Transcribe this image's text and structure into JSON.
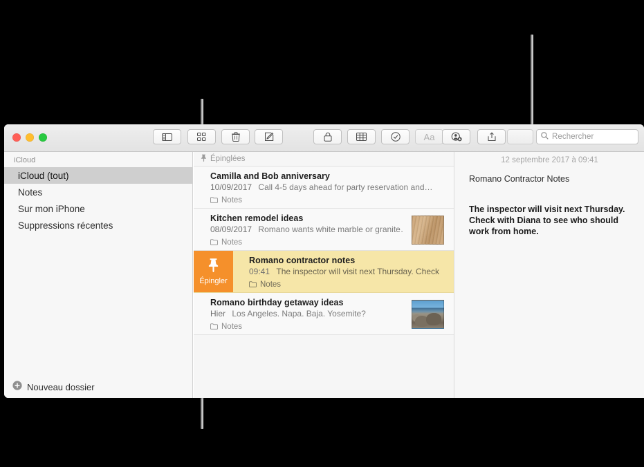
{
  "window": {
    "traffic_lights": [
      "close",
      "minimize",
      "zoom"
    ]
  },
  "toolbar": {
    "buttons": [
      {
        "name": "sidebar-toggle-button",
        "icon": "sidebar-icon"
      },
      {
        "name": "gallery-view-button",
        "icon": "grid-icon"
      },
      {
        "name": "delete-note-button",
        "icon": "trash-icon"
      },
      {
        "name": "new-note-button",
        "icon": "compose-icon"
      },
      {
        "name": "lock-note-button",
        "icon": "lock-icon"
      },
      {
        "name": "add-table-button",
        "icon": "table-icon"
      },
      {
        "name": "checklist-button",
        "icon": "checkmark-circle-icon"
      },
      {
        "name": "format-button",
        "icon": "aa-icon",
        "label": "Aa"
      },
      {
        "name": "add-people-button",
        "icon": "add-person-icon"
      },
      {
        "name": "share-button",
        "icon": "share-icon"
      }
    ],
    "format_label": "Aa"
  },
  "search": {
    "placeholder": "Rechercher",
    "icon": "search-icon",
    "value": ""
  },
  "sidebar": {
    "header": "iCloud",
    "items": [
      {
        "label": "iCloud (tout)",
        "selected": true
      },
      {
        "label": "Notes",
        "selected": false
      },
      {
        "label": "Sur mon iPhone",
        "selected": false
      },
      {
        "label": "Suppressions récentes",
        "selected": false
      }
    ],
    "footer": {
      "label": "Nouveau dossier",
      "icon": "plus-circle-icon"
    }
  },
  "notes_list": {
    "section_header": {
      "label": "Épinglées",
      "icon": "pin-icon"
    },
    "pin_action": {
      "label": "Épingler",
      "icon": "pin-icon",
      "color": "#f5902b"
    },
    "rows": [
      {
        "title": "Camilla and Bob anniversary",
        "date": "10/09/2017",
        "snippet": "Call 4-5 days ahead for party reservation and…",
        "folder": "Notes",
        "folder_icon": "folder-icon",
        "thumbnail": "",
        "state": "normal"
      },
      {
        "title": "Kitchen remodel ideas",
        "date": "08/09/2017",
        "snippet": "Romano wants white marble or granite…",
        "folder": "Notes",
        "folder_icon": "folder-icon",
        "thumbnail": "wood-countertop-photo",
        "state": "normal"
      },
      {
        "title": "Romano contractor notes",
        "date": "09:41",
        "snippet": "The inspector will visit next Thursday. Check",
        "folder": "Notes",
        "folder_icon": "folder-icon",
        "thumbnail": "",
        "state": "swiped-pin"
      },
      {
        "title": "Romano birthday getaway ideas",
        "date": "Hier",
        "snippet": "Los Angeles. Napa. Baja. Yosemite?",
        "folder": "Notes",
        "folder_icon": "folder-icon",
        "thumbnail": "beach-rocks-photo",
        "state": "normal"
      }
    ]
  },
  "detail": {
    "date": "12 septembre 2017 à 09:41",
    "title": "Romano Contractor Notes",
    "paragraph": "The inspector will visit next Thursday. Check with Diana to see who should work from home."
  },
  "colors": {
    "pin_orange": "#f5902b",
    "pinned_row": "#f6e6a8",
    "selection_gray": "#cfcfcf"
  }
}
